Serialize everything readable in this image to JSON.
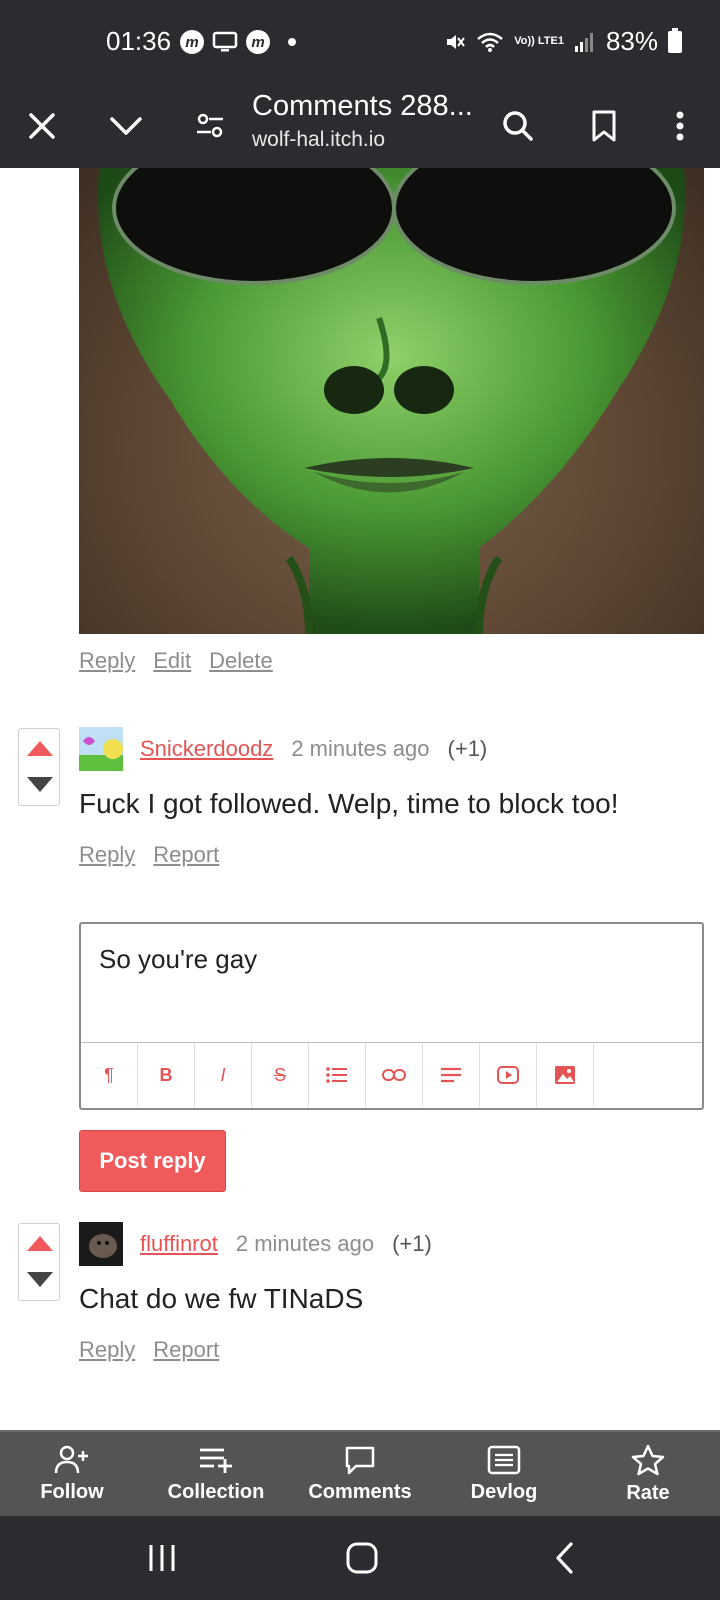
{
  "status_bar": {
    "time": "01:36",
    "network": "Vo)) LTE1",
    "battery": "83%"
  },
  "toolbar": {
    "title": "Comments 288...",
    "subtitle": "wolf-hal.itch.io"
  },
  "post_actions": {
    "reply": "Reply",
    "edit": "Edit",
    "delete": "Delete"
  },
  "comments": [
    {
      "user": "Snickerdoodz",
      "time": "2 minutes ago",
      "score": "(+1)",
      "body": "Fuck I got followed. Welp, time to block too!",
      "reply": "Reply",
      "report": "Report"
    },
    {
      "user": "fluffinrot",
      "time": "2 minutes ago",
      "score": "(+1)",
      "body": "Chat do we fw TINaDS",
      "reply": "Reply",
      "report": "Report"
    }
  ],
  "reply_editor": {
    "value": "So you're gay",
    "post_button": "Post reply"
  },
  "editor_tools": [
    "paragraph-icon",
    "bold-icon",
    "italic-icon",
    "strikethrough-icon",
    "list-icon",
    "link-icon",
    "align-icon",
    "video-icon",
    "image-icon"
  ],
  "bottom_nav": [
    {
      "label": "Follow",
      "icon": "follow-icon"
    },
    {
      "label": "Collection",
      "icon": "collection-icon"
    },
    {
      "label": "Comments",
      "icon": "comments-icon"
    },
    {
      "label": "Devlog",
      "icon": "devlog-icon"
    },
    {
      "label": "Rate",
      "icon": "star-icon"
    }
  ],
  "colors": {
    "accent": "#f05a5a",
    "bar": "#2b2c30",
    "nav": "#545454"
  }
}
